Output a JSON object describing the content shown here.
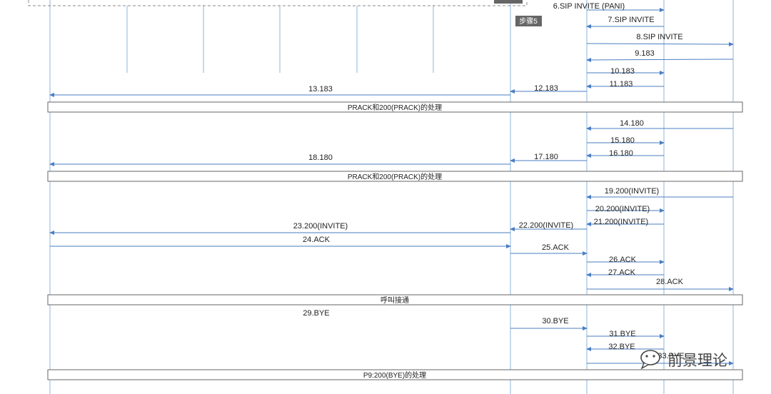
{
  "colors": {
    "lifeline": "#8db4dc",
    "arrow": "#4a7ec2",
    "banner_border": "#666666",
    "step_tag": "#666666"
  },
  "step_tags": [
    {
      "id": "tag-step5",
      "label": "步骤5"
    }
  ],
  "messages": [
    {
      "label": "6.SIP INVITE (PANI)"
    },
    {
      "label": "7.SIP INVITE"
    },
    {
      "label": "8.SIP INVITE"
    },
    {
      "label": "9.183"
    },
    {
      "label": "10.183"
    },
    {
      "label": "11.183"
    },
    {
      "label": "12.183"
    },
    {
      "label": "13.183"
    },
    {
      "label": "14.180"
    },
    {
      "label": "15.180"
    },
    {
      "label": "16.180"
    },
    {
      "label": "17.180"
    },
    {
      "label": "18.180"
    },
    {
      "label": "19.200(INVITE)"
    },
    {
      "label": "20.200(INVITE)"
    },
    {
      "label": "21.200(INVITE)"
    },
    {
      "label": "22.200(INVITE)"
    },
    {
      "label": "23.200(INVITE)"
    },
    {
      "label": "24.ACK"
    },
    {
      "label": "25.ACK"
    },
    {
      "label": "26.ACK"
    },
    {
      "label": "27.ACK"
    },
    {
      "label": "28.ACK"
    },
    {
      "label": "29.BYE"
    },
    {
      "label": "30.BYE"
    },
    {
      "label": "31.BYE"
    },
    {
      "label": "32.BYE"
    },
    {
      "label": "33.BYE"
    }
  ],
  "banners": [
    {
      "label": "PRACK和200(PRACK)的处理"
    },
    {
      "label": "PRACK和200(PRACK)的处理"
    },
    {
      "label": "呼叫接通"
    },
    {
      "label": "P9:200(BYE)的处理"
    }
  ],
  "watermark": {
    "text": "前景理论"
  }
}
